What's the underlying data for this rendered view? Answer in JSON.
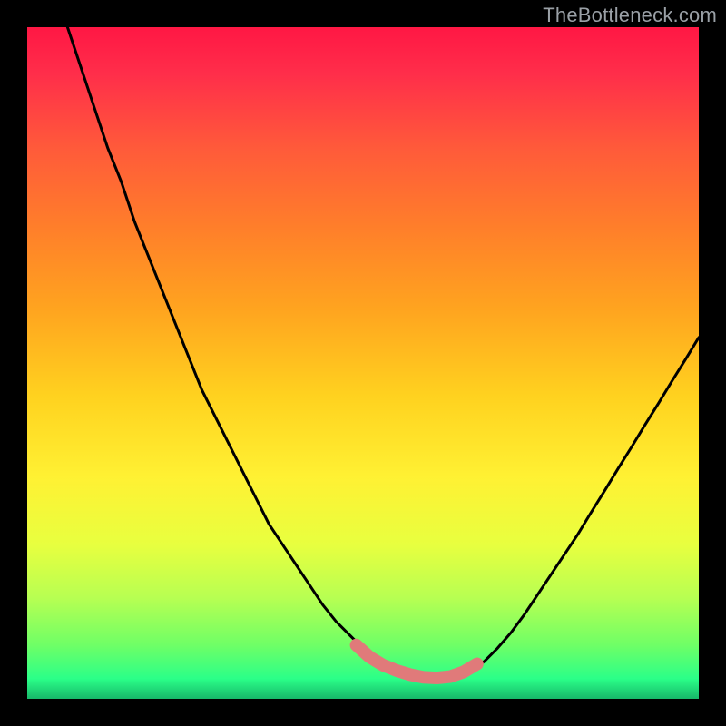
{
  "watermark": "TheBottleneck.com",
  "chart_data": {
    "type": "line",
    "title": "",
    "xlabel": "",
    "ylabel": "",
    "xlim": [
      0,
      100
    ],
    "ylim": [
      0,
      100
    ],
    "series": [
      {
        "name": "bottleneck-curve",
        "x": [
          6,
          8,
          10,
          12,
          14,
          16,
          18,
          20,
          22,
          24,
          26,
          28,
          30,
          32,
          34,
          36,
          38,
          40,
          42,
          44,
          46,
          48,
          50,
          52,
          54,
          56,
          58,
          60,
          62,
          64,
          66,
          68,
          70,
          72,
          74,
          76,
          78,
          80,
          82,
          84,
          86,
          88,
          90,
          92,
          94,
          96,
          98,
          100
        ],
        "y": [
          100,
          94,
          88,
          82,
          77,
          71,
          66,
          61,
          56,
          51,
          46,
          42,
          38,
          34,
          30,
          26,
          23,
          20,
          17,
          14,
          11.5,
          9.5,
          7.5,
          6,
          4.8,
          4,
          3.4,
          3.2,
          3.1,
          3.4,
          4.2,
          5.5,
          7.5,
          9.8,
          12.5,
          15.5,
          18.5,
          21.5,
          24.5,
          27.8,
          31,
          34.3,
          37.5,
          40.8,
          44,
          47.3,
          50.5,
          53.8
        ]
      }
    ],
    "highlight_segment": {
      "name": "recommended-range",
      "x": [
        49,
        51,
        53,
        55,
        57,
        59,
        61,
        63,
        65,
        67
      ],
      "y": [
        8.0,
        6.2,
        5.0,
        4.2,
        3.6,
        3.2,
        3.1,
        3.3,
        4.0,
        5.2
      ]
    },
    "gradient_stops": [
      {
        "offset": 0.0,
        "color": "#ff1744"
      },
      {
        "offset": 0.07,
        "color": "#ff2e4a"
      },
      {
        "offset": 0.18,
        "color": "#ff5a3a"
      },
      {
        "offset": 0.3,
        "color": "#ff7f2a"
      },
      {
        "offset": 0.42,
        "color": "#ffa41f"
      },
      {
        "offset": 0.55,
        "color": "#ffd21f"
      },
      {
        "offset": 0.67,
        "color": "#fff133"
      },
      {
        "offset": 0.77,
        "color": "#e8ff3f"
      },
      {
        "offset": 0.85,
        "color": "#b7ff52"
      },
      {
        "offset": 0.92,
        "color": "#6fff66"
      },
      {
        "offset": 0.97,
        "color": "#2bff88"
      },
      {
        "offset": 1.0,
        "color": "#17b86a"
      }
    ]
  }
}
